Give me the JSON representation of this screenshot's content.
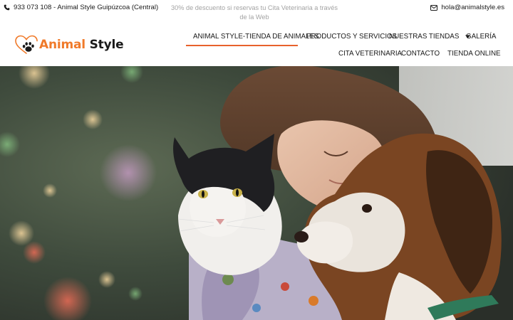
{
  "topbar": {
    "phone_text": "933 073 108 - Animal Style Guipúzcoa (Central)",
    "promo_text": "30% de descuento si reservas tu Cita Veterinaria a través de la Web",
    "email_text": "hola@animalstyle.es"
  },
  "logo": {
    "word1": "Animal",
    "word2": "Style"
  },
  "nav": {
    "items": [
      {
        "label": "ANIMAL STYLE-TIENDA DE ANIMALES",
        "active": true
      },
      {
        "label": "PRODUCTOS Y SERVICIOS"
      },
      {
        "label": "NUESTRAS TIENDAS",
        "has_dropdown": true
      },
      {
        "label": "GALERÍA"
      },
      {
        "label": "CITA VETERINARIA"
      },
      {
        "label": "CONTACTO"
      },
      {
        "label": "TIENDA ONLINE"
      }
    ]
  },
  "colors": {
    "accent": "#e8622c",
    "brand_orange": "#f07a2a",
    "text": "#1a1a1a",
    "muted": "#a3a3a3"
  },
  "icons": {
    "phone": "phone-icon",
    "email": "envelope-icon",
    "dropdown": "caret-down-icon",
    "logo": "heart-paw-icon"
  },
  "hero": {
    "image_subject": "child hugging a cat and a dog"
  }
}
